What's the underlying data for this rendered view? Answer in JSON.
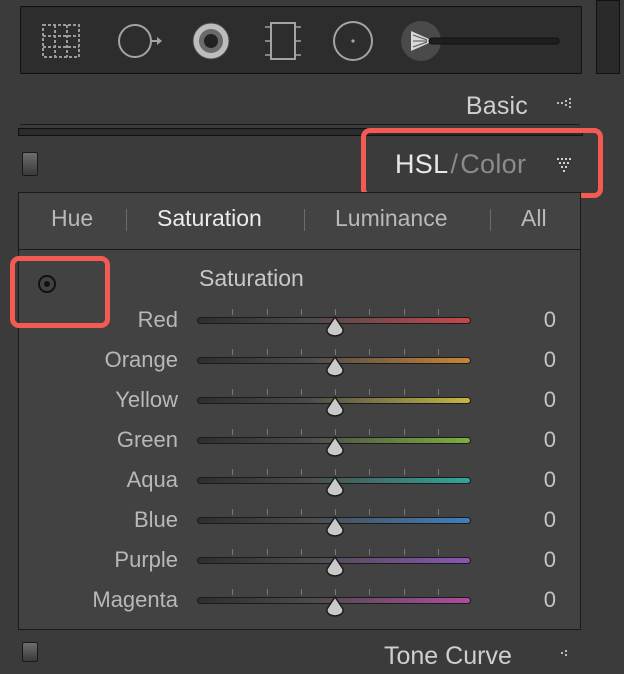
{
  "toolstrip": {
    "tools": [
      {
        "icon": "crop-overlay-icon"
      },
      {
        "icon": "spot-removal-icon"
      },
      {
        "icon": "red-eye-icon"
      },
      {
        "icon": "graduated-filter-icon"
      },
      {
        "icon": "radial-filter-icon"
      },
      {
        "icon": "adjustment-brush-icon"
      }
    ]
  },
  "basic_panel": {
    "title": "Basic"
  },
  "hsl_panel": {
    "title_hsl": "HSL",
    "title_separator": "/",
    "title_color": "Color",
    "tabs": [
      {
        "label": "Hue",
        "active": false
      },
      {
        "label": "Saturation",
        "active": true
      },
      {
        "label": "Luminance",
        "active": false
      },
      {
        "label": "All",
        "active": false
      }
    ],
    "section_title": "Saturation",
    "sliders": [
      {
        "label": "Red",
        "value": "0",
        "color": "#c8474b"
      },
      {
        "label": "Orange",
        "value": "0",
        "color": "#c98533"
      },
      {
        "label": "Yellow",
        "value": "0",
        "color": "#c7b83f"
      },
      {
        "label": "Green",
        "value": "0",
        "color": "#7bb13d"
      },
      {
        "label": "Aqua",
        "value": "0",
        "color": "#2fa79b"
      },
      {
        "label": "Blue",
        "value": "0",
        "color": "#3f7fc0"
      },
      {
        "label": "Purple",
        "value": "0",
        "color": "#8a56b6"
      },
      {
        "label": "Magenta",
        "value": "0",
        "color": "#b34aa0"
      }
    ]
  },
  "tone_curve_panel": {
    "title": "Tone Curve"
  },
  "colors": {
    "highlight": "#f25a52"
  }
}
